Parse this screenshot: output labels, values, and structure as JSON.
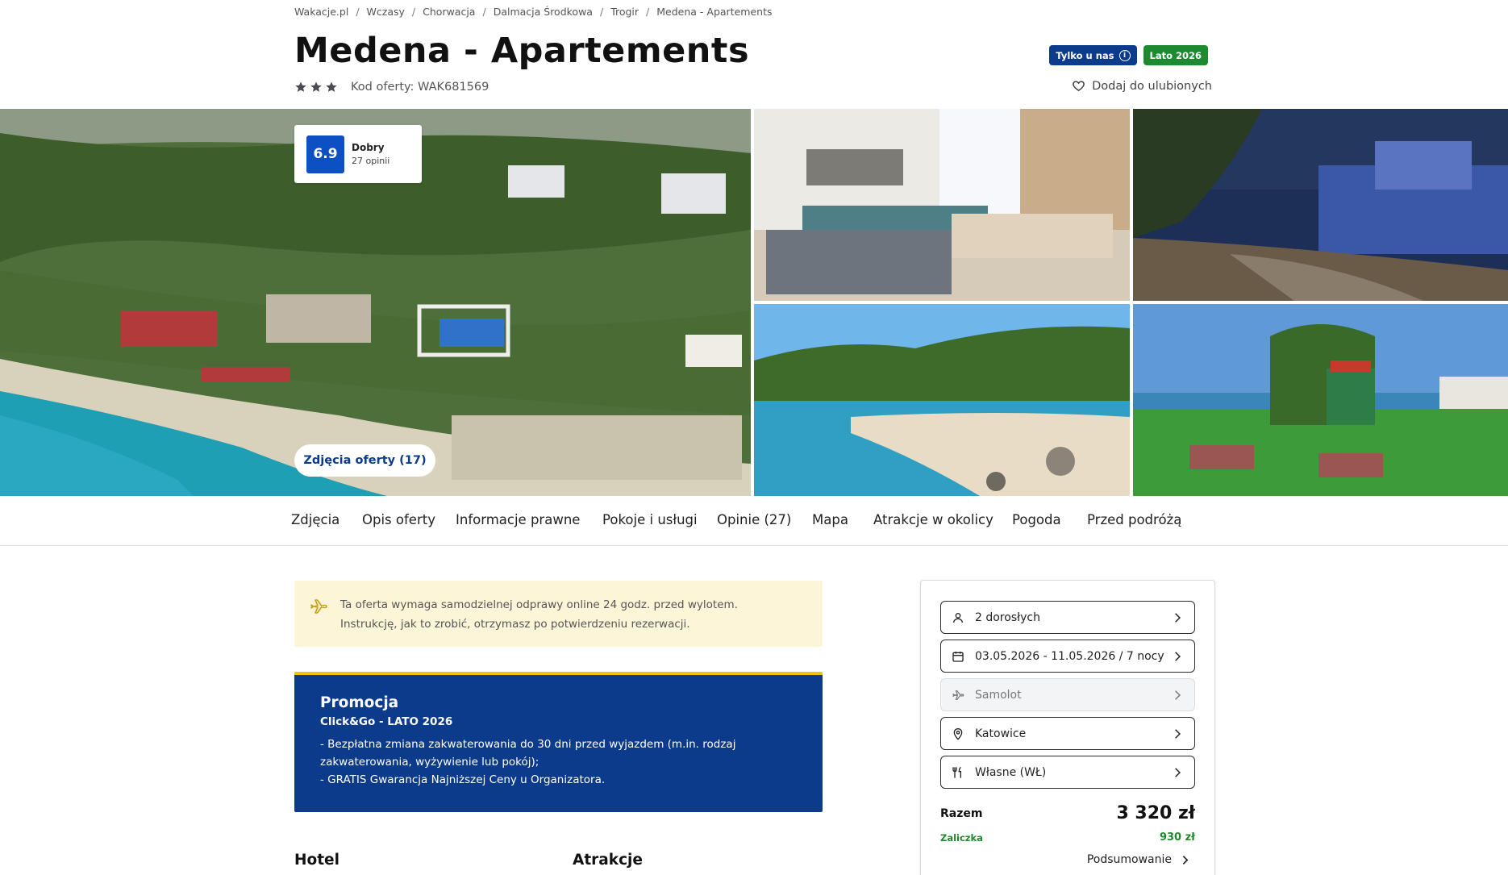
{
  "breadcrumb": [
    "Wakacje.pl",
    "Wczasy",
    "Chorwacja",
    "Dalmacja Środkowa",
    "Trogir",
    "Medena - Apartements"
  ],
  "hotel": {
    "name": "Medena - Apartements",
    "stars": 3,
    "offer_code": "Kod oferty: WAK681569"
  },
  "badges": {
    "exclusive": "Tylko u nas",
    "season": "Lato 2026"
  },
  "favorite_label": "Dodaj do ulubionych",
  "rating": {
    "score": "6.9",
    "label": "Dobry",
    "count": "27 opinii"
  },
  "photos_button": "Zdjęcia oferty (17)",
  "tabs": [
    "Zdjęcia",
    "Opis oferty",
    "Informacje prawne",
    "Pokoje i usługi",
    "Opinie (27)",
    "Mapa",
    "Atrakcje w okolicy",
    "Pogoda",
    "Przed podróżą"
  ],
  "notice": {
    "line1": "Ta oferta wymaga samodzielnej odprawy online 24 godz. przed wylotem.",
    "line2": "Instrukcję, jak to zrobić, otrzymasz po potwierdzeniu rezerwacji."
  },
  "promo": {
    "title": "Promocja",
    "subtitle": "Click&Go - LATO 2026",
    "body": "- Bezpłatna zmiana zakwaterowania do 30 dni przed wyjazdem (m.in. rodzaj zakwaterowania, wyżywienie lub pokój);\n- GRATIS Gwarancja Najniższej Ceny u Organizatora."
  },
  "sections": {
    "hotel": "Hotel",
    "attractions": "Atrakcje"
  },
  "booking": {
    "travelers": "2 dorosłych",
    "dates": "03.05.2026 - 11.05.2026 / 7 nocy",
    "transport": "Samolot",
    "departure": "Katowice",
    "board": "Własne (WŁ)",
    "total_label": "Razem",
    "total_value": "3 320 zł",
    "deposit_label": "Zaliczka",
    "deposit_value": "930 zł",
    "summary_link": "Podsumowanie"
  },
  "colors": {
    "brand_blue": "#0c3b8c",
    "rating_blue": "#0c50c3",
    "green": "#1e8a2f",
    "promo_accent": "#f2c400",
    "notice_bg": "#fdf5d7"
  }
}
